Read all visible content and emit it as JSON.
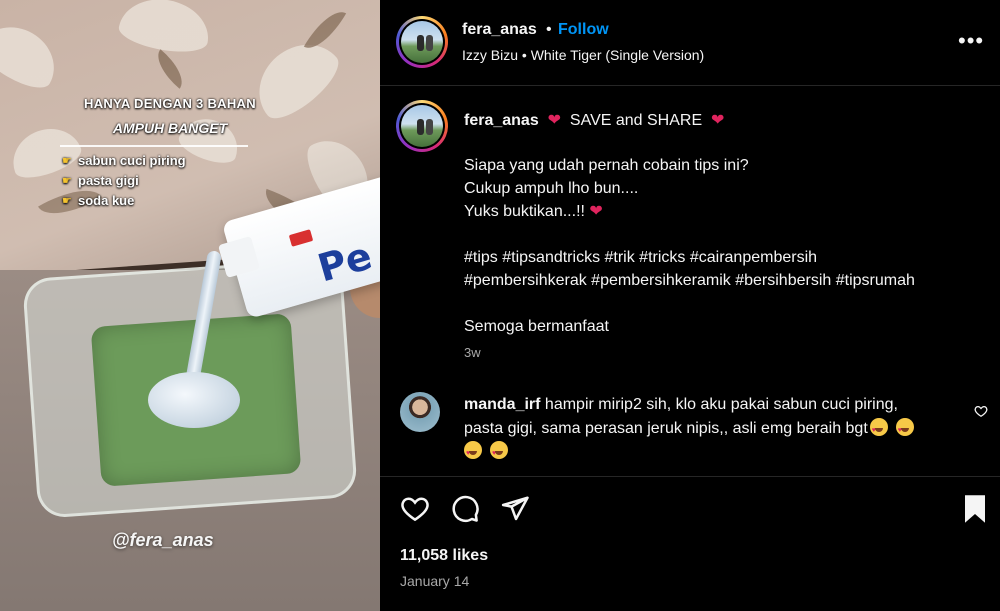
{
  "media": {
    "overlay_title": "HANYA DENGAN 3 BAHAN",
    "overlay_subtitle": "AMPUH BANGET",
    "ingredients": [
      "sabun cuci piring",
      "pasta gigi",
      "soda kue"
    ],
    "watermark": "@fera_anas",
    "tube_logo": "Pe"
  },
  "header": {
    "username": "fera_anas",
    "separator": "•",
    "follow_label": "Follow",
    "music": "Izzy Bizu • White Tiger (Single Version)",
    "more_icon": "more-horizontal-icon"
  },
  "caption": {
    "username": "fera_anas",
    "headline": "SAVE and SHARE",
    "lines": [
      "Siapa yang udah pernah cobain tips ini?",
      "Cukup ampuh lho bun....",
      "Yuks buktikan...!!"
    ],
    "hashtags_line1": "#tips #tipsandtricks #trik #tricks #cairanpembersih",
    "hashtags_line2": "#pembersihkerak #pembersihkeramik #bersihbersih #tipsrumah",
    "closing": "Semoga bermanfaat",
    "time": "3w"
  },
  "comment": {
    "username": "manda_irf",
    "text_line1": "hampir mirip2 sih, klo aku pakai sabun cuci piring,",
    "text_line2": "pasta gigi, sama perasan jeruk nipis,, asli emg beraih bgt"
  },
  "actions": {
    "likes": "11,058 likes",
    "date": "January 14"
  },
  "colors": {
    "accent": "#0095f6",
    "heart": "#e0245e",
    "background": "#000000",
    "muted": "#a8a8a8"
  }
}
